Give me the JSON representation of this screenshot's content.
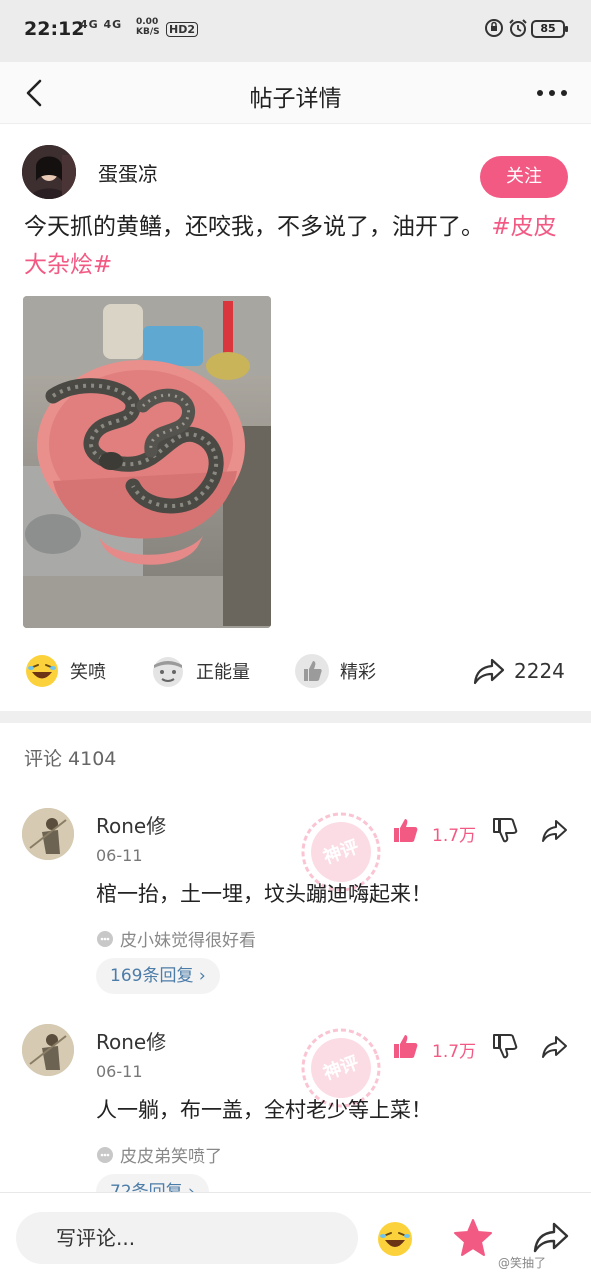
{
  "status_bar": {
    "time": "22:12",
    "network": "4G 4G",
    "speed_value": "0.00",
    "speed_unit": "KB/S",
    "hd_badge": "HD2",
    "battery": "85"
  },
  "nav": {
    "title": "帖子详情",
    "back_icon": "chevron-left-icon",
    "more_icon": "more-dots-icon"
  },
  "post": {
    "author": "蛋蛋凉",
    "follow_label": "关注",
    "text": "今天抓的黄鳝，还咬我，不多说了，油开了。",
    "hashtag": "#皮皮大杂烩#",
    "image_icon": "photo-snake-in-basin"
  },
  "reactions": {
    "items": [
      {
        "label": "笑喷",
        "icon": "laughing-emoji-icon"
      },
      {
        "label": "正能量",
        "icon": "positive-energy-emoji-icon"
      },
      {
        "label": "精彩",
        "icon": "thumbs-up-icon"
      }
    ],
    "share_count": "2224"
  },
  "comments_header": "评论 4104",
  "comments": [
    {
      "name": "Rone修",
      "date": "06-11",
      "text": "棺一抬，土一埋，坟头蹦迪嗨起来！",
      "likers": "皮小妹觉得很好看",
      "replies": "169条回复 ›",
      "like_count": "1.7万",
      "stamp": "神评"
    },
    {
      "name": "Rone修",
      "date": "06-11",
      "text": "人一躺，布一盖，全村老少等上菜！",
      "likers": "皮皮弟笑喷了",
      "replies": "72条回复 ›",
      "like_count": "1.7万",
      "stamp": "神评"
    }
  ],
  "bottom_bar": {
    "input_placeholder": "写评论...",
    "watermark": "@笑抽了"
  },
  "colors": {
    "accent": "#f25a84",
    "link": "#4c7ca8"
  }
}
